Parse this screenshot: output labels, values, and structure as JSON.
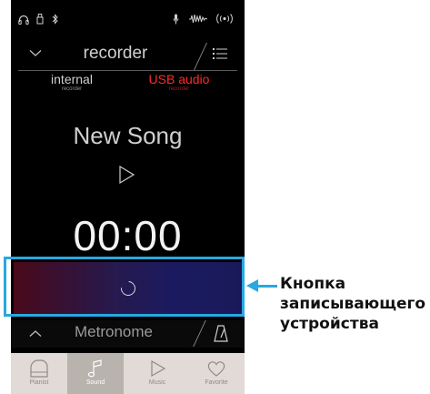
{
  "colors": {
    "accent_red": "#ff2b2b",
    "callout_blue": "#27a9e1",
    "inactive_text": "#cfcfcf",
    "tabbar_bg": "#e2dad6"
  },
  "status_icons": [
    "headphones-icon",
    "usb-icon",
    "bluetooth-icon",
    "microphone-icon",
    "audio-waveform-icon",
    "wireless-icon"
  ],
  "recorder_header": {
    "title": "recorder",
    "left_icon": "chevron-down-icon",
    "right_icon": "list-icon"
  },
  "sources": [
    {
      "label": "internal",
      "sublabel": "recorder",
      "selected": false
    },
    {
      "label": "USB audio",
      "sublabel": "recorder",
      "selected": true
    }
  ],
  "song": {
    "title": "New Song",
    "time": "00:00"
  },
  "metronome": {
    "title": "Metronome",
    "left_icon": "chevron-up-icon",
    "right_icon": "metronome-icon"
  },
  "tabs": [
    {
      "label": "Pianist",
      "icon": "piano-icon",
      "active": false
    },
    {
      "label": "Sound",
      "icon": "music-note-icon",
      "active": true
    },
    {
      "label": "Music",
      "icon": "play-icon",
      "active": false
    },
    {
      "label": "Favorite",
      "icon": "heart-icon",
      "active": false
    }
  ],
  "callout": {
    "lines": [
      "Кнопка",
      "записывающего",
      "устройства"
    ]
  }
}
